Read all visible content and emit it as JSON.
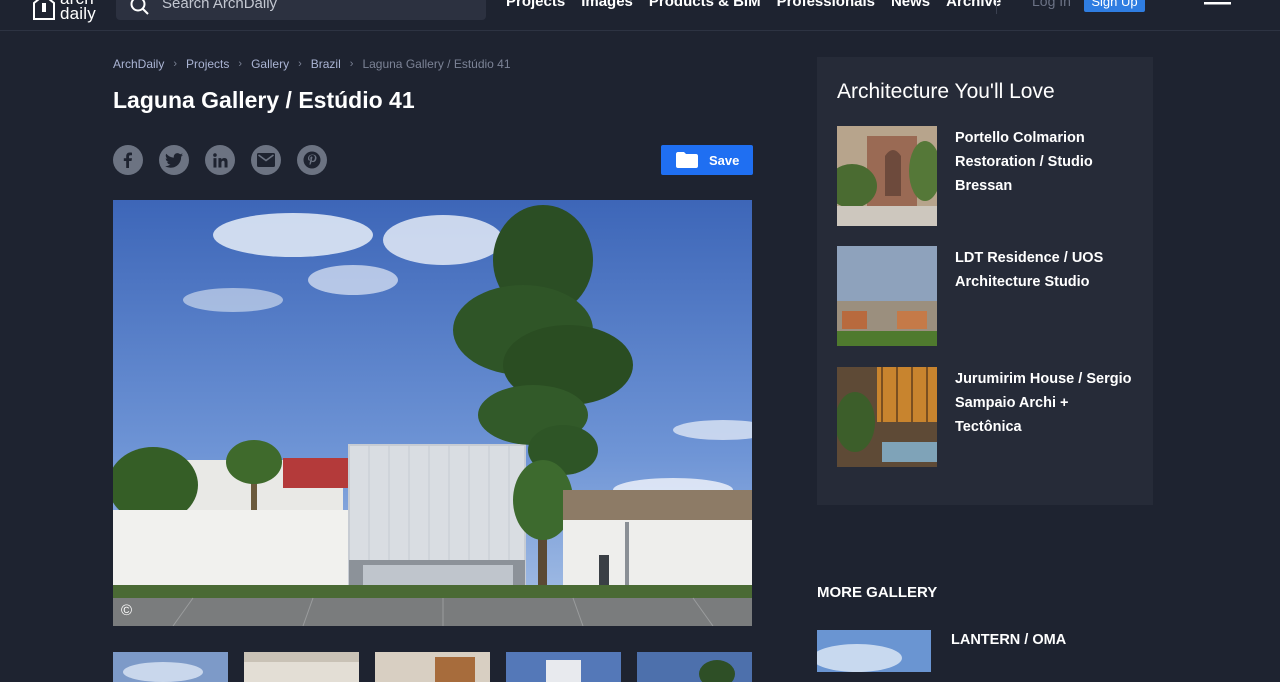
{
  "header": {
    "logo_text_top": "arch",
    "logo_text_bottom": "daily",
    "search_placeholder": "Search ArchDaily",
    "nav": [
      "Projects",
      "Images",
      "Products & BIM",
      "Professionals",
      "News",
      "Archive"
    ],
    "login_label": "Log In",
    "signup_label": "Sign Up"
  },
  "breadcrumb": {
    "items": [
      "ArchDaily",
      "Projects",
      "Gallery",
      "Brazil"
    ],
    "current": "Laguna Gallery / Estúdio 41"
  },
  "article": {
    "title": "Laguna Gallery / Estúdio 41",
    "save_label": "Save",
    "share_icons": [
      "facebook-icon",
      "twitter-icon",
      "linkedin-icon",
      "email-icon",
      "pinterest-icon"
    ],
    "copyright_symbol": "©"
  },
  "sidebar": {
    "heading": "Architecture You'll Love",
    "items": [
      {
        "title": "Portello Colmarion Restoration / Studio Bressan"
      },
      {
        "title": "LDT Residence / UOS Architecture Studio"
      },
      {
        "title": "Jurumirim House / Sergio Sampaio Archi + Tectônica"
      }
    ]
  },
  "more_gallery": {
    "heading": "MORE GALLERY",
    "items": [
      {
        "title": "LANTERN / OMA"
      }
    ]
  },
  "colors": {
    "background": "#1e2330",
    "card": "#262b38",
    "accent": "#1f6ff2",
    "link": "#aab4d4"
  }
}
